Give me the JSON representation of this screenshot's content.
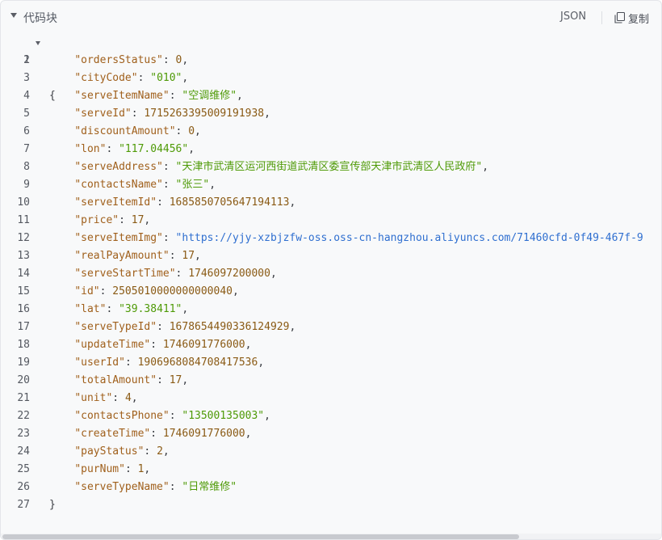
{
  "header": {
    "title": "代码块",
    "language": "JSON",
    "copy_label": "复制"
  },
  "code": {
    "open_brace": "{",
    "close_brace": "}",
    "entries": [
      {
        "key": "\"ordersStatus\"",
        "value": "0",
        "type": "num",
        "comma": ","
      },
      {
        "key": "\"cityCode\"",
        "value": "\"010\"",
        "type": "str",
        "comma": ","
      },
      {
        "key": "\"serveItemName\"",
        "value": "\"空调维修\"",
        "type": "str",
        "comma": ","
      },
      {
        "key": "\"serveId\"",
        "value": "1715263395009191938",
        "type": "num",
        "comma": ","
      },
      {
        "key": "\"discountAmount\"",
        "value": "0",
        "type": "num",
        "comma": ","
      },
      {
        "key": "\"lon\"",
        "value": "\"117.04456\"",
        "type": "str",
        "comma": ","
      },
      {
        "key": "\"serveAddress\"",
        "value": "\"天津市武清区运河西街道武清区委宣传部天津市武清区人民政府\"",
        "type": "str",
        "comma": ","
      },
      {
        "key": "\"contactsName\"",
        "value": "\"张三\"",
        "type": "str",
        "comma": ","
      },
      {
        "key": "\"serveItemId\"",
        "value": "1685850705647194113",
        "type": "num",
        "comma": ","
      },
      {
        "key": "\"price\"",
        "value": "17",
        "type": "num",
        "comma": ","
      },
      {
        "key": "\"serveItemImg\"",
        "value": "\"https://yjy-xzbjzfw-oss.oss-cn-hangzhou.aliyuncs.com/71460cfd-0f49-467f-9",
        "type": "url",
        "comma": ""
      },
      {
        "key": "\"realPayAmount\"",
        "value": "17",
        "type": "num",
        "comma": ","
      },
      {
        "key": "\"serveStartTime\"",
        "value": "1746097200000",
        "type": "num",
        "comma": ","
      },
      {
        "key": "\"id\"",
        "value": "2505010000000000040",
        "type": "num",
        "comma": ","
      },
      {
        "key": "\"lat\"",
        "value": "\"39.38411\"",
        "type": "str",
        "comma": ","
      },
      {
        "key": "\"serveTypeId\"",
        "value": "1678654490336124929",
        "type": "num",
        "comma": ","
      },
      {
        "key": "\"updateTime\"",
        "value": "1746091776000",
        "type": "num",
        "comma": ","
      },
      {
        "key": "\"userId\"",
        "value": "1906968084708417536",
        "type": "num",
        "comma": ","
      },
      {
        "key": "\"totalAmount\"",
        "value": "17",
        "type": "num",
        "comma": ","
      },
      {
        "key": "\"unit\"",
        "value": "4",
        "type": "num",
        "comma": ","
      },
      {
        "key": "\"contactsPhone\"",
        "value": "\"13500135003\"",
        "type": "str",
        "comma": ","
      },
      {
        "key": "\"createTime\"",
        "value": "1746091776000",
        "type": "num",
        "comma": ","
      },
      {
        "key": "\"payStatus\"",
        "value": "2",
        "type": "num",
        "comma": ","
      },
      {
        "key": "\"purNum\"",
        "value": "1",
        "type": "num",
        "comma": ","
      },
      {
        "key": "\"serveTypeName\"",
        "value": "\"日常维修\"",
        "type": "str",
        "comma": ""
      }
    ]
  }
}
